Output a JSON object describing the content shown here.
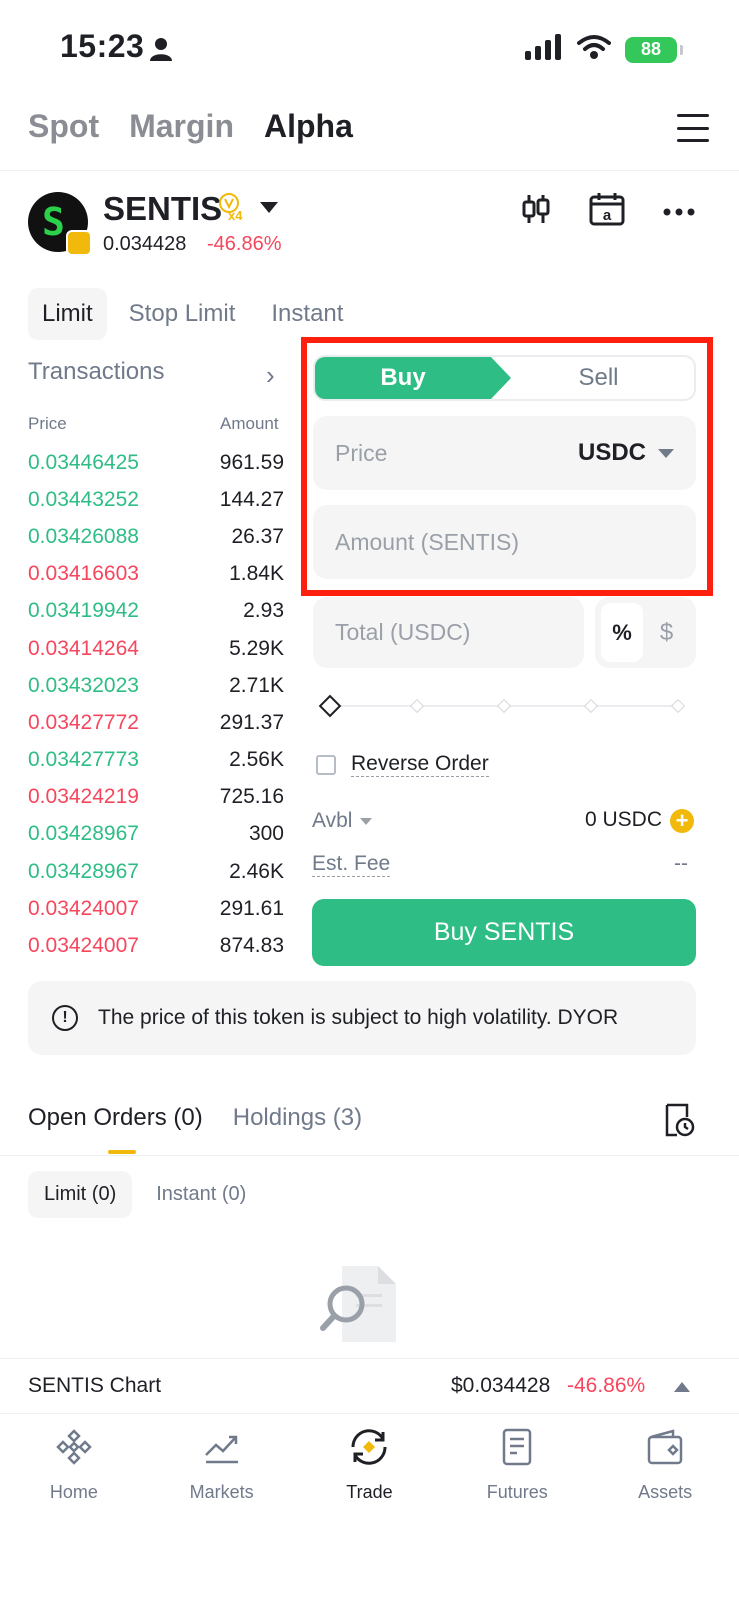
{
  "status": {
    "time": "15:23",
    "battery": "88"
  },
  "top_tabs": [
    "Spot",
    "Margin",
    "Alpha"
  ],
  "token": {
    "name": "SENTIS",
    "badge": "x4",
    "price": "0.034428",
    "change": "-46.86%",
    "logo_letter": "S"
  },
  "order_tabs": [
    "Limit",
    "Stop Limit",
    "Instant"
  ],
  "transactions": {
    "title": "Transactions",
    "price_head": "Price",
    "amount_head": "Amount",
    "rows": [
      {
        "price": "0.03446425",
        "amount": "961.59",
        "dir": "up"
      },
      {
        "price": "0.03443252",
        "amount": "144.27",
        "dir": "up"
      },
      {
        "price": "0.03426088",
        "amount": "26.37",
        "dir": "up"
      },
      {
        "price": "0.03416603",
        "amount": "1.84K",
        "dir": "down"
      },
      {
        "price": "0.03419942",
        "amount": "2.93",
        "dir": "up"
      },
      {
        "price": "0.03414264",
        "amount": "5.29K",
        "dir": "down"
      },
      {
        "price": "0.03432023",
        "amount": "2.71K",
        "dir": "up"
      },
      {
        "price": "0.03427772",
        "amount": "291.37",
        "dir": "down"
      },
      {
        "price": "0.03427773",
        "amount": "2.56K",
        "dir": "up"
      },
      {
        "price": "0.03424219",
        "amount": "725.16",
        "dir": "down"
      },
      {
        "price": "0.03428967",
        "amount": "300",
        "dir": "up"
      },
      {
        "price": "0.03428967",
        "amount": "2.46K",
        "dir": "up"
      },
      {
        "price": "0.03424007",
        "amount": "291.61",
        "dir": "down"
      },
      {
        "price": "0.03424007",
        "amount": "874.83",
        "dir": "down"
      }
    ]
  },
  "form": {
    "buy_label": "Buy",
    "sell_label": "Sell",
    "price_placeholder": "Price",
    "price_unit": "USDC",
    "amount_placeholder": "Amount (SENTIS)",
    "total_placeholder": "Total (USDC)",
    "pct_label": "%",
    "dollar_label": "$",
    "reverse_label": "Reverse Order",
    "avbl_label": "Avbl",
    "avbl_value": "0 USDC",
    "fee_label": "Est. Fee",
    "fee_value": "--",
    "buy_button": "Buy SENTIS"
  },
  "warning": "The price of this token is subject to high volatility. DYOR",
  "orders": {
    "tabs": [
      "Open Orders (0)",
      "Holdings (3)"
    ],
    "sub_tabs": [
      "Limit (0)",
      "Instant (0)"
    ]
  },
  "chart_strip": {
    "title": "SENTIS Chart",
    "price": "$0.034428",
    "change": "-46.86%"
  },
  "nav": [
    "Home",
    "Markets",
    "Trade",
    "Futures",
    "Assets"
  ],
  "colors": {
    "green": "#2ebd85",
    "red": "#f6465d",
    "yellow": "#f0b90b",
    "highlight": "#ff1f0f"
  }
}
